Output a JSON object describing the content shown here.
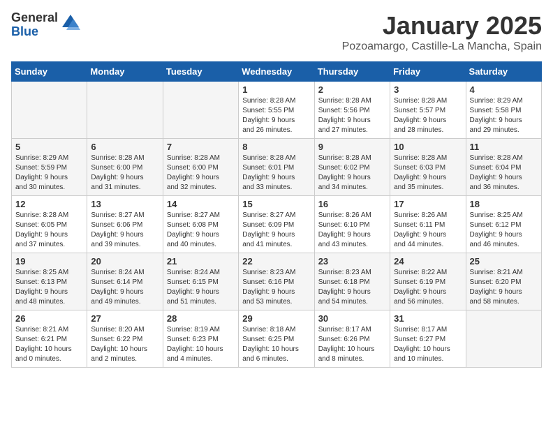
{
  "logo": {
    "general": "General",
    "blue": "Blue"
  },
  "title": "January 2025",
  "subtitle": "Pozoamargo, Castille-La Mancha, Spain",
  "days_of_week": [
    "Sunday",
    "Monday",
    "Tuesday",
    "Wednesday",
    "Thursday",
    "Friday",
    "Saturday"
  ],
  "weeks": [
    [
      {
        "day": "",
        "info": "",
        "empty": true
      },
      {
        "day": "",
        "info": "",
        "empty": true
      },
      {
        "day": "",
        "info": "",
        "empty": true
      },
      {
        "day": "1",
        "info": "Sunrise: 8:28 AM\nSunset: 5:55 PM\nDaylight: 9 hours\nand 26 minutes.",
        "empty": false
      },
      {
        "day": "2",
        "info": "Sunrise: 8:28 AM\nSunset: 5:56 PM\nDaylight: 9 hours\nand 27 minutes.",
        "empty": false
      },
      {
        "day": "3",
        "info": "Sunrise: 8:28 AM\nSunset: 5:57 PM\nDaylight: 9 hours\nand 28 minutes.",
        "empty": false
      },
      {
        "day": "4",
        "info": "Sunrise: 8:29 AM\nSunset: 5:58 PM\nDaylight: 9 hours\nand 29 minutes.",
        "empty": false
      }
    ],
    [
      {
        "day": "5",
        "info": "Sunrise: 8:29 AM\nSunset: 5:59 PM\nDaylight: 9 hours\nand 30 minutes.",
        "empty": false
      },
      {
        "day": "6",
        "info": "Sunrise: 8:28 AM\nSunset: 6:00 PM\nDaylight: 9 hours\nand 31 minutes.",
        "empty": false
      },
      {
        "day": "7",
        "info": "Sunrise: 8:28 AM\nSunset: 6:00 PM\nDaylight: 9 hours\nand 32 minutes.",
        "empty": false
      },
      {
        "day": "8",
        "info": "Sunrise: 8:28 AM\nSunset: 6:01 PM\nDaylight: 9 hours\nand 33 minutes.",
        "empty": false
      },
      {
        "day": "9",
        "info": "Sunrise: 8:28 AM\nSunset: 6:02 PM\nDaylight: 9 hours\nand 34 minutes.",
        "empty": false
      },
      {
        "day": "10",
        "info": "Sunrise: 8:28 AM\nSunset: 6:03 PM\nDaylight: 9 hours\nand 35 minutes.",
        "empty": false
      },
      {
        "day": "11",
        "info": "Sunrise: 8:28 AM\nSunset: 6:04 PM\nDaylight: 9 hours\nand 36 minutes.",
        "empty": false
      }
    ],
    [
      {
        "day": "12",
        "info": "Sunrise: 8:28 AM\nSunset: 6:05 PM\nDaylight: 9 hours\nand 37 minutes.",
        "empty": false
      },
      {
        "day": "13",
        "info": "Sunrise: 8:27 AM\nSunset: 6:06 PM\nDaylight: 9 hours\nand 39 minutes.",
        "empty": false
      },
      {
        "day": "14",
        "info": "Sunrise: 8:27 AM\nSunset: 6:08 PM\nDaylight: 9 hours\nand 40 minutes.",
        "empty": false
      },
      {
        "day": "15",
        "info": "Sunrise: 8:27 AM\nSunset: 6:09 PM\nDaylight: 9 hours\nand 41 minutes.",
        "empty": false
      },
      {
        "day": "16",
        "info": "Sunrise: 8:26 AM\nSunset: 6:10 PM\nDaylight: 9 hours\nand 43 minutes.",
        "empty": false
      },
      {
        "day": "17",
        "info": "Sunrise: 8:26 AM\nSunset: 6:11 PM\nDaylight: 9 hours\nand 44 minutes.",
        "empty": false
      },
      {
        "day": "18",
        "info": "Sunrise: 8:25 AM\nSunset: 6:12 PM\nDaylight: 9 hours\nand 46 minutes.",
        "empty": false
      }
    ],
    [
      {
        "day": "19",
        "info": "Sunrise: 8:25 AM\nSunset: 6:13 PM\nDaylight: 9 hours\nand 48 minutes.",
        "empty": false
      },
      {
        "day": "20",
        "info": "Sunrise: 8:24 AM\nSunset: 6:14 PM\nDaylight: 9 hours\nand 49 minutes.",
        "empty": false
      },
      {
        "day": "21",
        "info": "Sunrise: 8:24 AM\nSunset: 6:15 PM\nDaylight: 9 hours\nand 51 minutes.",
        "empty": false
      },
      {
        "day": "22",
        "info": "Sunrise: 8:23 AM\nSunset: 6:16 PM\nDaylight: 9 hours\nand 53 minutes.",
        "empty": false
      },
      {
        "day": "23",
        "info": "Sunrise: 8:23 AM\nSunset: 6:18 PM\nDaylight: 9 hours\nand 54 minutes.",
        "empty": false
      },
      {
        "day": "24",
        "info": "Sunrise: 8:22 AM\nSunset: 6:19 PM\nDaylight: 9 hours\nand 56 minutes.",
        "empty": false
      },
      {
        "day": "25",
        "info": "Sunrise: 8:21 AM\nSunset: 6:20 PM\nDaylight: 9 hours\nand 58 minutes.",
        "empty": false
      }
    ],
    [
      {
        "day": "26",
        "info": "Sunrise: 8:21 AM\nSunset: 6:21 PM\nDaylight: 10 hours\nand 0 minutes.",
        "empty": false
      },
      {
        "day": "27",
        "info": "Sunrise: 8:20 AM\nSunset: 6:22 PM\nDaylight: 10 hours\nand 2 minutes.",
        "empty": false
      },
      {
        "day": "28",
        "info": "Sunrise: 8:19 AM\nSunset: 6:23 PM\nDaylight: 10 hours\nand 4 minutes.",
        "empty": false
      },
      {
        "day": "29",
        "info": "Sunrise: 8:18 AM\nSunset: 6:25 PM\nDaylight: 10 hours\nand 6 minutes.",
        "empty": false
      },
      {
        "day": "30",
        "info": "Sunrise: 8:17 AM\nSunset: 6:26 PM\nDaylight: 10 hours\nand 8 minutes.",
        "empty": false
      },
      {
        "day": "31",
        "info": "Sunrise: 8:17 AM\nSunset: 6:27 PM\nDaylight: 10 hours\nand 10 minutes.",
        "empty": false
      },
      {
        "day": "",
        "info": "",
        "empty": true
      }
    ]
  ]
}
